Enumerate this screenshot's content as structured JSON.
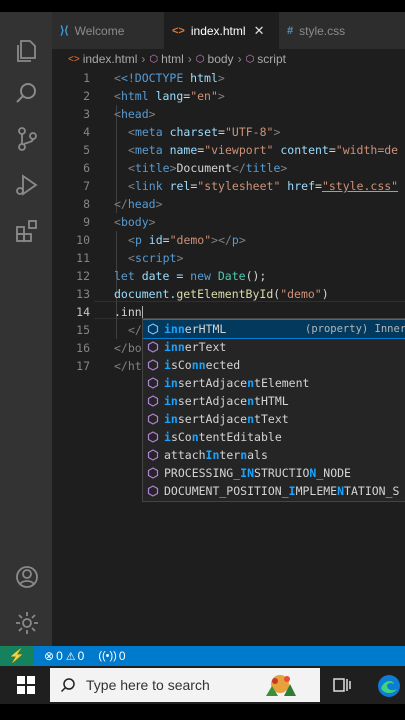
{
  "tabs": [
    {
      "label": "Welcome",
      "icon": "vscode-icon"
    },
    {
      "label": "index.html",
      "icon": "html-icon",
      "close": "✕"
    },
    {
      "label": "style.css",
      "icon": "#"
    }
  ],
  "breadcrumb": [
    "index.html",
    "html",
    "body",
    "script"
  ],
  "line_numbers": [
    "1",
    "2",
    "3",
    "4",
    "5",
    "6",
    "7",
    "8",
    "9",
    "10",
    "11",
    "12",
    "13",
    "14",
    "15",
    "16",
    "17"
  ],
  "code": {
    "l1_tag": "<!DOCTYPE",
    "l1_rest": " html",
    "l1_end": ">",
    "l2_open": "<",
    "l2_tag": "html",
    "l2_attr": " lang",
    "l2_eq": "=",
    "l2_val": "\"en\"",
    "l2_close": ">",
    "l3": "head",
    "l4_tag": "meta",
    "l4_attr": " charset",
    "l4_val": "\"UTF-8\"",
    "l5_tag": "meta",
    "l5_attr1": " name",
    "l5_val1": "\"viewport\"",
    "l5_attr2": " content",
    "l5_val2": "\"width=de",
    "l6_tag": "title",
    "l6_text": "Document",
    "l7_tag": "link",
    "l7_attr1": " rel",
    "l7_val1": "\"stylesheet\"",
    "l7_attr2": " href",
    "l7_val2": "\"style.css\"",
    "l8": "head",
    "l9": "body",
    "l10_tag": "p",
    "l10_attr": " id",
    "l10_val": "\"demo\"",
    "l10_end": "p",
    "l11": "script",
    "l12_kw": "let",
    "l12_var": " date = ",
    "l12_new": "new",
    "l12_fn": " Date",
    "l12_end": "();",
    "l13_obj": "document.",
    "l13_fn": "getElementById",
    "l13_p": "(",
    "l13_str": "\"demo\"",
    "l13_end": ")",
    "l14": ".inn",
    "l15": "</",
    "l16": "</bo",
    "l17": "</ht"
  },
  "suggestions": [
    {
      "pre": "",
      "hl": "inn",
      "post": "erHTML",
      "detail": "(property) InnerH"
    },
    {
      "pre": "",
      "hl": "inn",
      "post": "erText"
    },
    {
      "pre": "",
      "hl": "i",
      "mid": "sCo",
      "hl2": "nn",
      "post": "ected"
    },
    {
      "pre": "",
      "hl": "in",
      "mid": "sertAdjace",
      "hl2": "n",
      "post": "tElement"
    },
    {
      "pre": "",
      "hl": "in",
      "mid": "sertAdjace",
      "hl2": "n",
      "post": "tHTML"
    },
    {
      "pre": "",
      "hl": "in",
      "mid": "sertAdjace",
      "hl2": "n",
      "post": "tText"
    },
    {
      "pre": "",
      "hl": "i",
      "mid": "sCo",
      "hl2": "n",
      "post": "tentEditable"
    },
    {
      "pre": "attach",
      "hl": "In",
      "mid": "ter",
      "hl2": "n",
      "post": "als"
    },
    {
      "pre": "PROCESSING_",
      "hl": "IN",
      "mid": "STRUCTIO",
      "hl2": "N",
      "post": "_NODE"
    },
    {
      "pre": "DOCUMENT_POSITION_",
      "hl": "I",
      "mid": "MPLEME",
      "hl2": "N",
      "post": "TATION_S"
    }
  ],
  "statusbar": {
    "remote_icon": "⚡",
    "errors": "0",
    "warnings": "0",
    "broadcast": "0"
  },
  "taskbar": {
    "search_placeholder": "Type here to search"
  },
  "colors": {
    "activity_bar": "#333333",
    "editor_bg": "#1e1e1e",
    "status_bar": "#007acc",
    "remote": "#16825d",
    "suggest_bg": "#252526",
    "suggest_selected": "#04395e",
    "match_highlight": "#18a3ff"
  }
}
